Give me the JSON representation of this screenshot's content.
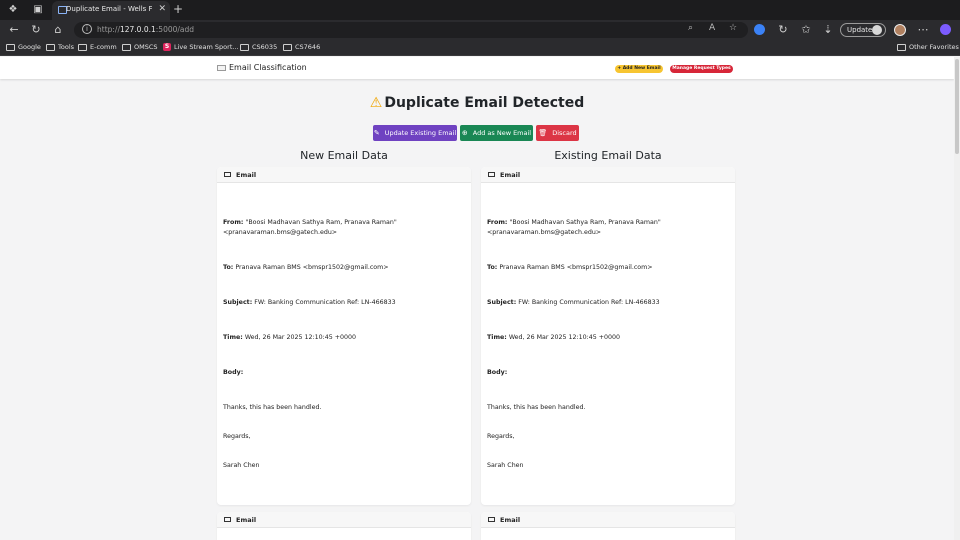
{
  "browser": {
    "tab_title": "Duplicate Email - Wells Fargo E",
    "url_prefix": "http://",
    "url_host": "127.0.0.1",
    "url_path": ":5000/add",
    "update_label": "Update",
    "bookmarks": [
      "Google",
      "Tools",
      "E-comm",
      "OMSCS",
      "Live Stream Sport...",
      "CS6035",
      "CS7646"
    ],
    "other_favorites": "Other Favorites"
  },
  "app": {
    "brand": "Email Classification",
    "add_new_email": "+ Add New Email",
    "manage_request_types": "Manage Request Types"
  },
  "page": {
    "heading": "Duplicate Email Detected",
    "buttons": {
      "update": "Update Existing Email",
      "add": "Add as New Email",
      "discard": "Discard"
    },
    "new_title": "New Email Data",
    "existing_title": "Existing Email Data"
  },
  "email": {
    "card_label": "Email",
    "from_label": "From:",
    "from_value": "\"Boosi Madhavan Sathya Ram, Pranava Raman\" <pranavaraman.bms@gatech.edu>",
    "to_label": "To:",
    "to_value": "Pranava Raman BMS <bmspr1502@gmail.com>",
    "subject_label": "Subject:",
    "subject_value": "FW: Banking Communication Ref: LN-466833",
    "time_label": "Time:",
    "time_value": "Wed, 26 Mar 2025 12:10:45 +0000",
    "body_label": "Body:",
    "body_line1": "Thanks, this has been handled.",
    "body_line2": "Regards,",
    "body_line3": "Sarah Chen"
  },
  "colors": {
    "purple": "#6f42c1",
    "green": "#198754",
    "red": "#dc3545",
    "badge_yellow": "#f7c531",
    "badge_red": "#d72638"
  }
}
